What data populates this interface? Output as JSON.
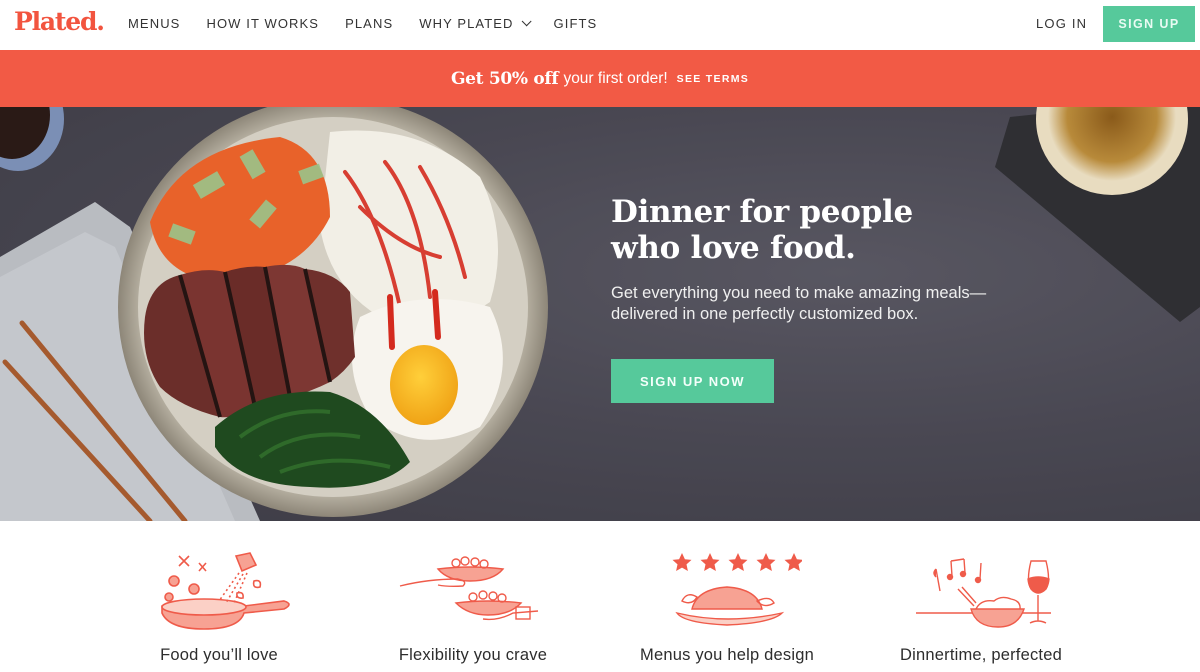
{
  "header": {
    "logo": "Plated.",
    "nav": [
      {
        "label": "MENUS",
        "has_dropdown": false
      },
      {
        "label": "HOW IT WORKS",
        "has_dropdown": false
      },
      {
        "label": "PLANS",
        "has_dropdown": false
      },
      {
        "label": "WHY PLATED",
        "has_dropdown": true
      },
      {
        "label": "GIFTS",
        "has_dropdown": false
      }
    ],
    "login_label": "LOG IN",
    "signup_label": "SIGN UP"
  },
  "promo": {
    "bold_text": "Get 50% off",
    "text": "your first order!",
    "terms_link": "SEE TERMS"
  },
  "hero": {
    "title_line1": "Dinner for people",
    "title_line2": "who love food.",
    "subtitle_line1": "Get everything you need to make amazing meals—",
    "subtitle_line2": "delivered in one perfectly customized box.",
    "cta_label": "SIGN UP NOW",
    "image_description": "Steak rice bowl with fried egg, spinach, cucumber-carrot slaw and chopsticks on a slate surface"
  },
  "features": [
    {
      "label": "Food you’ll love",
      "icon": "skillet-icon"
    },
    {
      "label": "Flexibility you crave",
      "icon": "serving-plates-icon"
    },
    {
      "label": "Menus you help design",
      "icon": "five-star-roast-icon"
    },
    {
      "label": "Dinnertime, perfected",
      "icon": "bowl-and-wine-icon"
    }
  ],
  "colors": {
    "brand_red": "#f2543f",
    "promo_red": "#f25a45",
    "cta_green": "#56c99b",
    "illustration_red": "#ef5b4a"
  }
}
